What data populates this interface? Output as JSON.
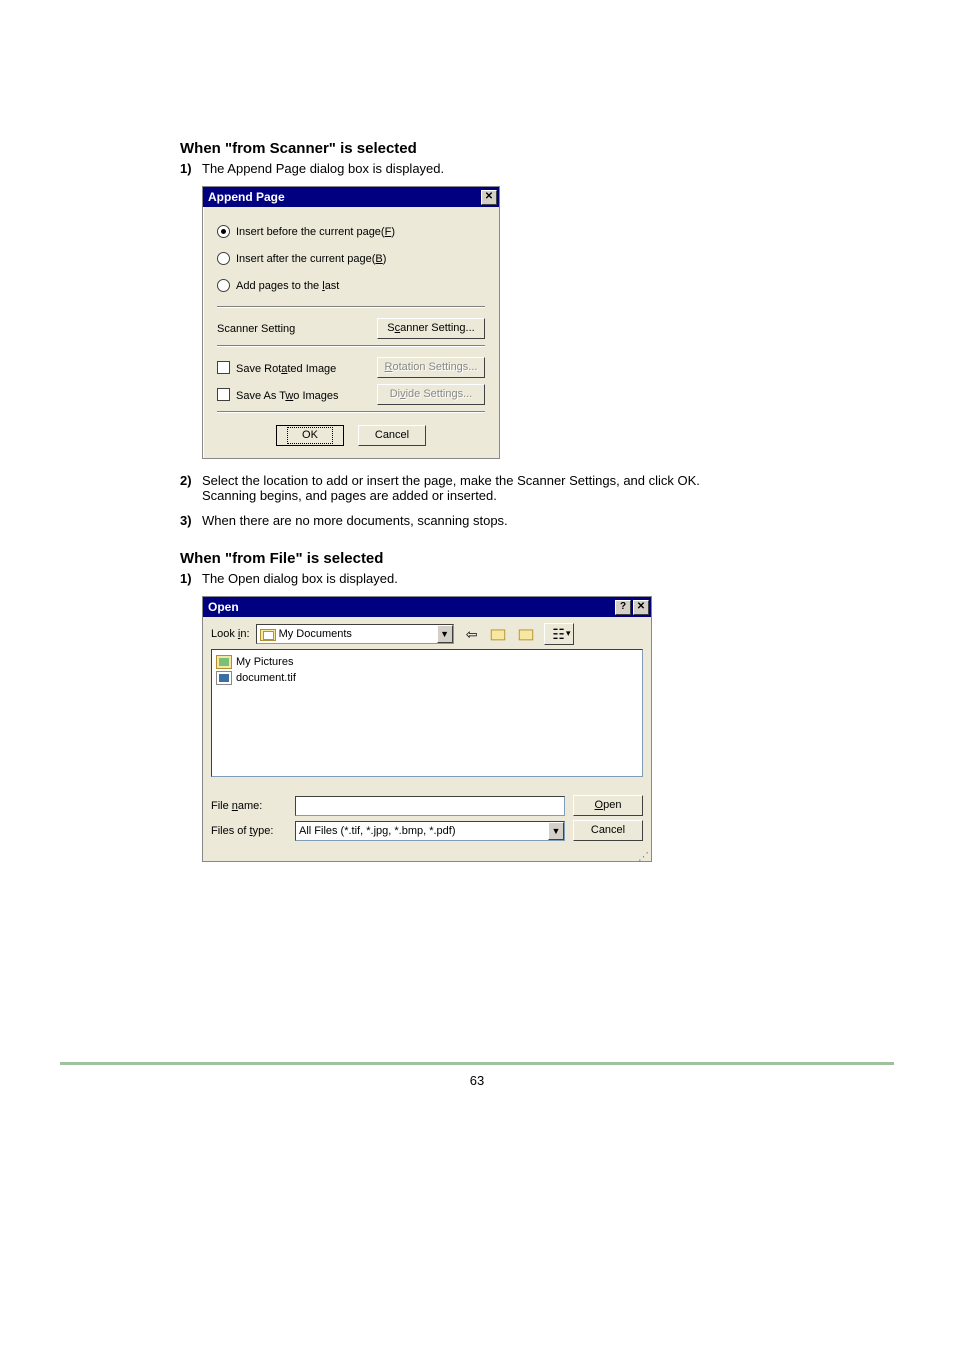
{
  "section1": {
    "heading": "When \"from Scanner\" is selected",
    "step1_num": "1)",
    "step1_text": "The Append Page dialog box is displayed.",
    "step2_num": "2)",
    "step2_text": "Select the location to add or insert the page, make the Scanner Settings, and click OK.",
    "step2_sub": "Scanning begins, and pages are added or inserted.",
    "step3_num": "3)",
    "step3_text": "When there are no more documents, scanning stops."
  },
  "append_dialog": {
    "title": "Append Page",
    "radio1_pre": "Insert before the current page(",
    "radio1_u": "F",
    "radio1_post": ")",
    "radio2_pre": "Insert after the current page(",
    "radio2_u": "B",
    "radio2_post": ")",
    "radio3_pre": "Add pages to the ",
    "radio3_u": "l",
    "radio3_post": "ast",
    "scanner_label": "Scanner Setting",
    "scanner_btn_pre": "S",
    "scanner_btn_u": "c",
    "scanner_btn_post": "anner Setting...",
    "rotate_pre": "Save Rot",
    "rotate_u": "a",
    "rotate_post": "ted Image",
    "rotate_btn_u": "R",
    "rotate_btn_post": "otation Settings...",
    "two_pre": "Save As T",
    "two_u": "w",
    "two_post": "o Images",
    "divide_btn_pre": "Di",
    "divide_btn_u": "v",
    "divide_btn_post": "ide Settings...",
    "ok": "OK",
    "cancel": "Cancel"
  },
  "section2": {
    "heading": "When \"from File\" is selected",
    "step1_num": "1)",
    "step1_text": "The Open dialog box is displayed."
  },
  "open_dialog": {
    "title": "Open",
    "lookin_pre": "Look ",
    "lookin_u": "i",
    "lookin_post": "n:",
    "lookin_value": "My Documents",
    "file_pictures": "My Pictures",
    "file_doc": "document.tif",
    "filename_pre": "File ",
    "filename_u": "n",
    "filename_post": "ame:",
    "filetype_pre": "Files of ",
    "filetype_u": "t",
    "filetype_post": "ype:",
    "filetype_value": "All Files (*.tif, *.jpg, *.bmp, *.pdf)",
    "open_u": "O",
    "open_post": "pen",
    "cancel": "Cancel"
  },
  "footer": {
    "page": "63"
  }
}
